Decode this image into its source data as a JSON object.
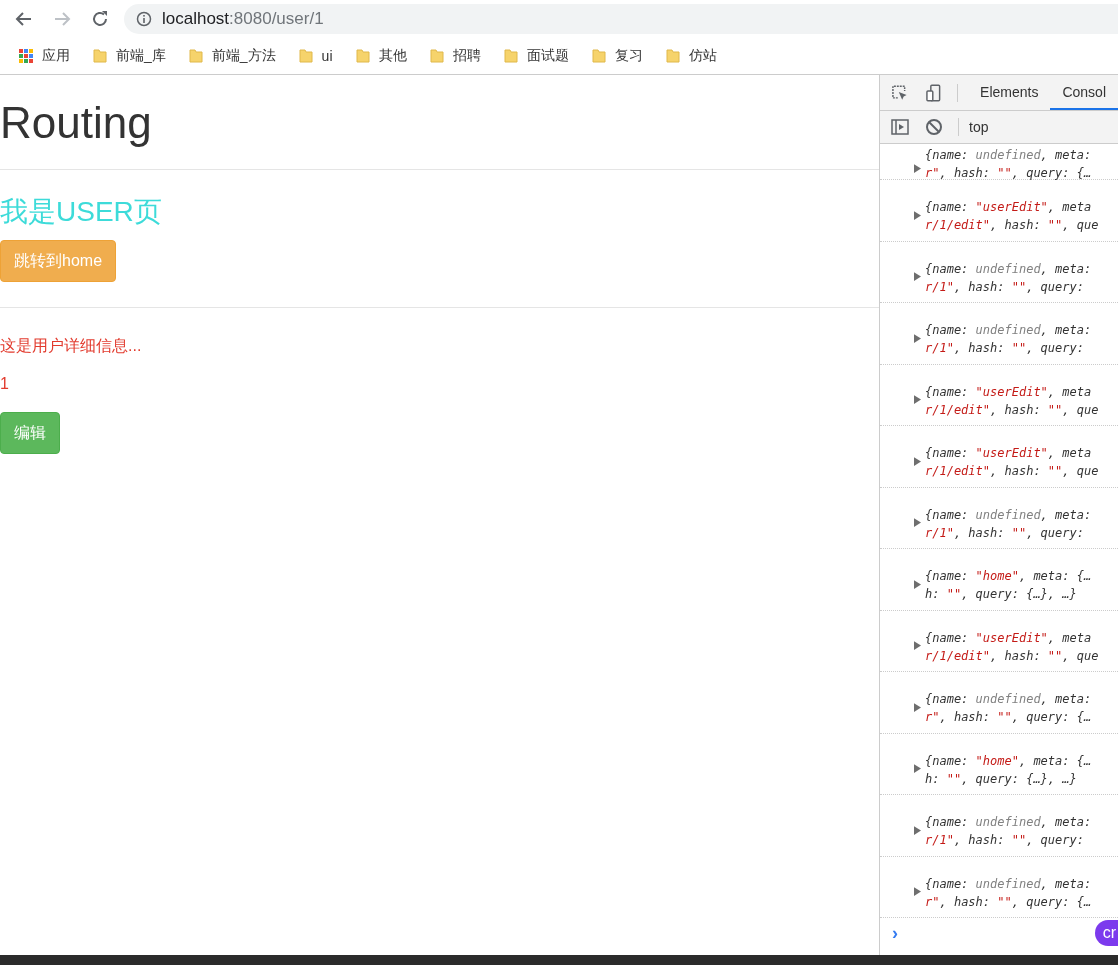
{
  "browser": {
    "url_host": "localhost",
    "url_rest": ":8080/user/1"
  },
  "bookmarks": [
    {
      "kind": "apps",
      "label": "应用"
    },
    {
      "kind": "folder",
      "label": "前端_库"
    },
    {
      "kind": "folder",
      "label": "前端_方法"
    },
    {
      "kind": "folder",
      "label": "ui"
    },
    {
      "kind": "folder",
      "label": "其他"
    },
    {
      "kind": "folder",
      "label": "招聘"
    },
    {
      "kind": "folder",
      "label": "面试题"
    },
    {
      "kind": "folder",
      "label": "复习"
    },
    {
      "kind": "folder",
      "label": "仿站"
    }
  ],
  "page": {
    "title": "Routing",
    "heading": "我是USER页",
    "home_button": "跳转到home",
    "detail": "这是用户详细信息...",
    "user_id": "1",
    "edit_button": "编辑"
  },
  "devtools": {
    "tabs": [
      {
        "label": "Elements",
        "selected": false
      },
      {
        "label": "Consol",
        "selected": true
      }
    ],
    "context": "top",
    "entries": [
      {
        "line1": [
          {
            "kind": "plain",
            "text": "{name: "
          },
          {
            "kind": "undef",
            "text": "undefined"
          },
          {
            "kind": "plain",
            "text": ", meta:"
          }
        ],
        "line2": [
          {
            "kind": "string",
            "text": "r\""
          },
          {
            "kind": "plain",
            "text": ", hash: "
          },
          {
            "kind": "string",
            "text": "\"\""
          },
          {
            "kind": "plain",
            "text": ", query: {…"
          }
        ]
      },
      {
        "line1": [
          {
            "kind": "plain",
            "text": "{name: "
          },
          {
            "kind": "string",
            "text": "\"userEdit\""
          },
          {
            "kind": "plain",
            "text": ", meta"
          }
        ],
        "line2": [
          {
            "kind": "string",
            "text": "r/1/edit\""
          },
          {
            "kind": "plain",
            "text": ", hash: "
          },
          {
            "kind": "string",
            "text": "\"\""
          },
          {
            "kind": "plain",
            "text": ", que"
          }
        ]
      },
      {
        "line1": [
          {
            "kind": "plain",
            "text": "{name: "
          },
          {
            "kind": "undef",
            "text": "undefined"
          },
          {
            "kind": "plain",
            "text": ", meta:"
          }
        ],
        "line2": [
          {
            "kind": "string",
            "text": "r/1\""
          },
          {
            "kind": "plain",
            "text": ", hash: "
          },
          {
            "kind": "string",
            "text": "\"\""
          },
          {
            "kind": "plain",
            "text": ", query:"
          }
        ]
      },
      {
        "line1": [
          {
            "kind": "plain",
            "text": "{name: "
          },
          {
            "kind": "undef",
            "text": "undefined"
          },
          {
            "kind": "plain",
            "text": ", meta:"
          }
        ],
        "line2": [
          {
            "kind": "string",
            "text": "r/1\""
          },
          {
            "kind": "plain",
            "text": ", hash: "
          },
          {
            "kind": "string",
            "text": "\"\""
          },
          {
            "kind": "plain",
            "text": ", query:"
          }
        ]
      },
      {
        "line1": [
          {
            "kind": "plain",
            "text": "{name: "
          },
          {
            "kind": "string",
            "text": "\"userEdit\""
          },
          {
            "kind": "plain",
            "text": ", meta"
          }
        ],
        "line2": [
          {
            "kind": "string",
            "text": "r/1/edit\""
          },
          {
            "kind": "plain",
            "text": ", hash: "
          },
          {
            "kind": "string",
            "text": "\"\""
          },
          {
            "kind": "plain",
            "text": ", que"
          }
        ]
      },
      {
        "line1": [
          {
            "kind": "plain",
            "text": "{name: "
          },
          {
            "kind": "string",
            "text": "\"userEdit\""
          },
          {
            "kind": "plain",
            "text": ", meta"
          }
        ],
        "line2": [
          {
            "kind": "string",
            "text": "r/1/edit\""
          },
          {
            "kind": "plain",
            "text": ", hash: "
          },
          {
            "kind": "string",
            "text": "\"\""
          },
          {
            "kind": "plain",
            "text": ", que"
          }
        ]
      },
      {
        "line1": [
          {
            "kind": "plain",
            "text": "{name: "
          },
          {
            "kind": "undef",
            "text": "undefined"
          },
          {
            "kind": "plain",
            "text": ", meta:"
          }
        ],
        "line2": [
          {
            "kind": "string",
            "text": "r/1\""
          },
          {
            "kind": "plain",
            "text": ", hash: "
          },
          {
            "kind": "string",
            "text": "\"\""
          },
          {
            "kind": "plain",
            "text": ", query:"
          }
        ]
      },
      {
        "line1": [
          {
            "kind": "plain",
            "text": "{name: "
          },
          {
            "kind": "string",
            "text": "\"home\""
          },
          {
            "kind": "plain",
            "text": ", meta: {…"
          }
        ],
        "line2": [
          {
            "kind": "plain",
            "text": "h: "
          },
          {
            "kind": "string",
            "text": "\"\""
          },
          {
            "kind": "plain",
            "text": ", query: {…}, …}"
          }
        ]
      },
      {
        "line1": [
          {
            "kind": "plain",
            "text": "{name: "
          },
          {
            "kind": "string",
            "text": "\"userEdit\""
          },
          {
            "kind": "plain",
            "text": ", meta"
          }
        ],
        "line2": [
          {
            "kind": "string",
            "text": "r/1/edit\""
          },
          {
            "kind": "plain",
            "text": ", hash: "
          },
          {
            "kind": "string",
            "text": "\"\""
          },
          {
            "kind": "plain",
            "text": ", que"
          }
        ]
      },
      {
        "line1": [
          {
            "kind": "plain",
            "text": "{name: "
          },
          {
            "kind": "undef",
            "text": "undefined"
          },
          {
            "kind": "plain",
            "text": ", meta:"
          }
        ],
        "line2": [
          {
            "kind": "string",
            "text": "r\""
          },
          {
            "kind": "plain",
            "text": ", hash: "
          },
          {
            "kind": "string",
            "text": "\"\""
          },
          {
            "kind": "plain",
            "text": ", query: {…"
          }
        ]
      },
      {
        "line1": [
          {
            "kind": "plain",
            "text": "{name: "
          },
          {
            "kind": "string",
            "text": "\"home\""
          },
          {
            "kind": "plain",
            "text": ", meta: {…"
          }
        ],
        "line2": [
          {
            "kind": "plain",
            "text": "h: "
          },
          {
            "kind": "string",
            "text": "\"\""
          },
          {
            "kind": "plain",
            "text": ", query: {…}, …}"
          }
        ]
      },
      {
        "line1": [
          {
            "kind": "plain",
            "text": "{name: "
          },
          {
            "kind": "undef",
            "text": "undefined"
          },
          {
            "kind": "plain",
            "text": ", meta:"
          }
        ],
        "line2": [
          {
            "kind": "string",
            "text": "r/1\""
          },
          {
            "kind": "plain",
            "text": ", hash: "
          },
          {
            "kind": "string",
            "text": "\"\""
          },
          {
            "kind": "plain",
            "text": ", query:"
          }
        ]
      },
      {
        "line1": [
          {
            "kind": "plain",
            "text": "{name: "
          },
          {
            "kind": "undef",
            "text": "undefined"
          },
          {
            "kind": "plain",
            "text": ", meta:"
          }
        ],
        "line2": [
          {
            "kind": "string",
            "text": "r\""
          },
          {
            "kind": "plain",
            "text": ", hash: "
          },
          {
            "kind": "string",
            "text": "\"\""
          },
          {
            "kind": "plain",
            "text": ", query: {…"
          }
        ]
      }
    ],
    "prompt": "›",
    "badge": "cr"
  }
}
